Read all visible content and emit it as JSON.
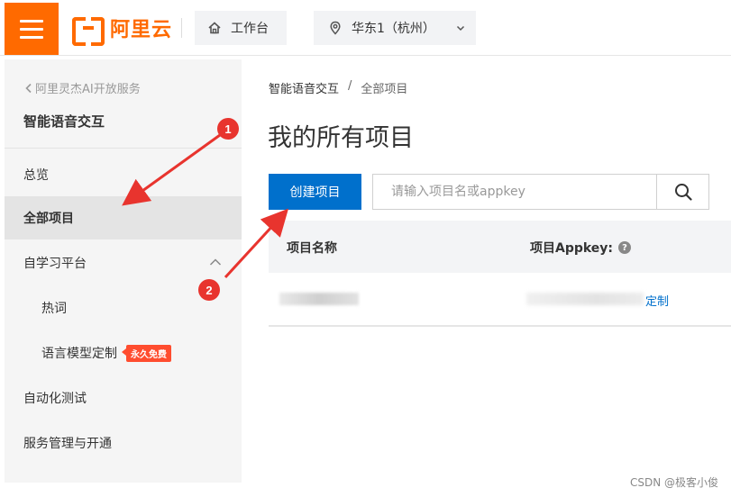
{
  "header": {
    "brand": "阿里云",
    "workbench_label": "工作台",
    "region_label": "华东1（杭州）"
  },
  "sidebar": {
    "back_label": "阿里灵杰AI开放服务",
    "product_title": "智能语音交互",
    "items": [
      {
        "label": "总览"
      },
      {
        "label": "全部项目"
      },
      {
        "label": "自学习平台"
      },
      {
        "label": "热词"
      },
      {
        "label": "语言模型定制",
        "badge": "永久免费"
      },
      {
        "label": "自动化测试"
      },
      {
        "label": "服务管理与开通"
      }
    ]
  },
  "main": {
    "breadcrumb": {
      "root": "智能语音交互",
      "sep": "/",
      "current": "全部项目"
    },
    "title": "我的所有项目",
    "create_button": "创建项目",
    "search_placeholder": "请输入项目名或appkey",
    "table": {
      "columns": [
        "项目名称",
        "项目Appkey:"
      ],
      "help_glyph": "?",
      "row_link_fragment": "定制"
    }
  },
  "annotations": {
    "step1": "1",
    "step2": "2",
    "color": "#e8342e"
  },
  "watermark": "CSDN @极客小俊",
  "colors": {
    "brand": "#ff6a00",
    "primary": "#0070cc"
  }
}
